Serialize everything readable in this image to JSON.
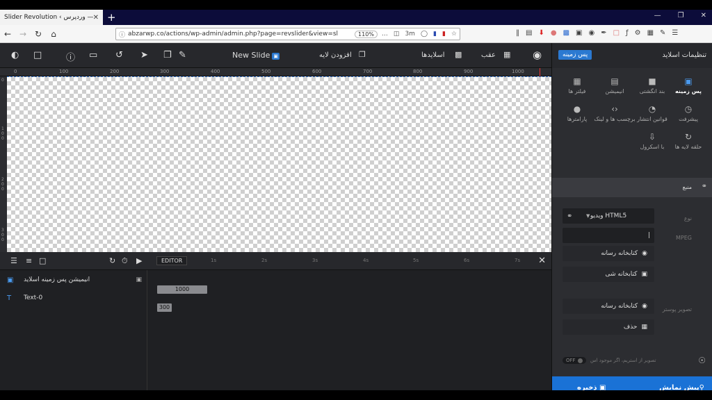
{
  "browser": {
    "tab_title": "Slider Revolution ‹ اسلایدر — وردپرس",
    "tab_close": "✕",
    "new_tab": "+",
    "url": "abzarwp.co/actions/wp-admin/admin.php?page=revslider&view=sl",
    "zoom": "110%",
    "url_extra": "3m",
    "win_min": "—",
    "win_max": "❐",
    "win_close": "✕"
  },
  "toolbar": {
    "new_slide": "New Slide",
    "new_slide_badge": "▣",
    "add_layer": "افزودن لایه",
    "slides": "اسلایدها",
    "back": "عقب"
  },
  "right_panel": {
    "title": "تنظیمات اسلاید",
    "bg_button": "پس زمینه",
    "tabs": [
      {
        "label": "پس زمینه",
        "icon": "▣"
      },
      {
        "label": "بند انگشتی",
        "icon": "■"
      },
      {
        "label": "انیمیشن",
        "icon": "▤"
      },
      {
        "label": "فیلتر ها",
        "icon": "▦"
      },
      {
        "label": "پیشرفت",
        "icon": "◷"
      },
      {
        "label": "قوانین انتشار",
        "icon": "◔"
      },
      {
        "label": "برچسب ها و لینک",
        "icon": "‹›"
      },
      {
        "label": "پارامترها",
        "icon": "●"
      },
      {
        "label": "حلقه لایه ها",
        "icon": "↻"
      },
      {
        "label": "با اسکرول",
        "icon": "⇩"
      }
    ],
    "section_label": "منبع",
    "type_label": "نوع",
    "type_value": "ویدیو HTML5",
    "mpeg_label": "MPEG",
    "media_library": "کتابخانه رسانه",
    "object_library": "کتابخانه شی",
    "poster_label": "تصویر پوستر",
    "poster_media_library": "کتابخانه رسانه",
    "delete": "حذف",
    "toggle_state": "OFF",
    "toggle_label": "تصویر از استریم، اگر موجود اس",
    "save": "ذخیره",
    "preview": "پیش نمایش"
  },
  "ruler": {
    "top_ticks": [
      "0",
      "100",
      "200",
      "300",
      "400",
      "500",
      "600",
      "700",
      "800",
      "900",
      "1000"
    ],
    "left_ticks": [
      "0",
      "100",
      "200",
      "300"
    ]
  },
  "timeline": {
    "editor_tag": "EDITOR",
    "ticks": [
      "1s",
      "2s",
      "3s",
      "4s",
      "5s",
      "6s",
      "7s"
    ],
    "layers": [
      {
        "name": "انیمیشن پس زمینه اسلاید",
        "icon": "▣",
        "bar_value": "1000"
      },
      {
        "name": "Text-0",
        "icon": "T",
        "bar_value": "300"
      }
    ],
    "close": "✕"
  }
}
